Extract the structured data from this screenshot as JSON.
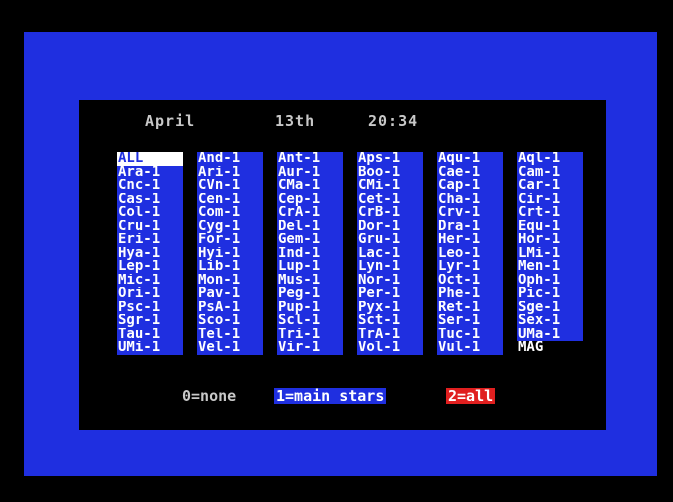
{
  "header": {
    "month": "April",
    "day": "13th",
    "time": "20:34"
  },
  "constellations": [
    "ALL",
    "And-1",
    "Ant-1",
    "Aps-1",
    "Aqu-1",
    "Aql-1",
    "Ara-1",
    "Ari-1",
    "Aur-1",
    "Boo-1",
    "Cae-1",
    "Cam-1",
    "Cnc-1",
    "CVn-1",
    "CMa-1",
    "CMi-1",
    "Cap-1",
    "Car-1",
    "Cas-1",
    "Cen-1",
    "Cep-1",
    "Cet-1",
    "Cha-1",
    "Cir-1",
    "Col-1",
    "Com-1",
    "CrA-1",
    "CrB-1",
    "Crv-1",
    "Crt-1",
    "Cru-1",
    "Cyg-1",
    "Del-1",
    "Dor-1",
    "Dra-1",
    "Equ-1",
    "Eri-1",
    "For-1",
    "Gem-1",
    "Gru-1",
    "Her-1",
    "Hor-1",
    "Hya-1",
    "Hyi-1",
    "Ind-1",
    "Lac-1",
    "Leo-1",
    "LMi-1",
    "Lep-1",
    "Lib-1",
    "Lup-1",
    "Lyn-1",
    "Lyr-1",
    "Men-1",
    "Mic-1",
    "Mon-1",
    "Mus-1",
    "Nor-1",
    "Oct-1",
    "Oph-1",
    "Ori-1",
    "Pav-1",
    "Peg-1",
    "Per-1",
    "Phe-1",
    "Pic-1",
    "Psc-1",
    "PsA-1",
    "Pup-1",
    "Pyx-1",
    "Ret-1",
    "Sge-1",
    "Sgr-1",
    "Sco-1",
    "Scl-1",
    "Sct-1",
    "Ser-1",
    "Sex-1",
    "Tau-1",
    "Tel-1",
    "Tri-1",
    "TrA-1",
    "Tuc-1",
    "UMa-1",
    "UMi-1",
    "Vel-1",
    "Vir-1",
    "Vol-1",
    "Vul-1",
    "MAG"
  ],
  "selected": "ALL",
  "footer": {
    "option_none": "0=none",
    "option_main": "1=main stars",
    "option_all": "2=all"
  },
  "colors": {
    "border_blue": "#1f2fe0",
    "panel_black": "#000000",
    "text_grey": "#c8c8c8",
    "highlight_red": "#e01f1f"
  }
}
